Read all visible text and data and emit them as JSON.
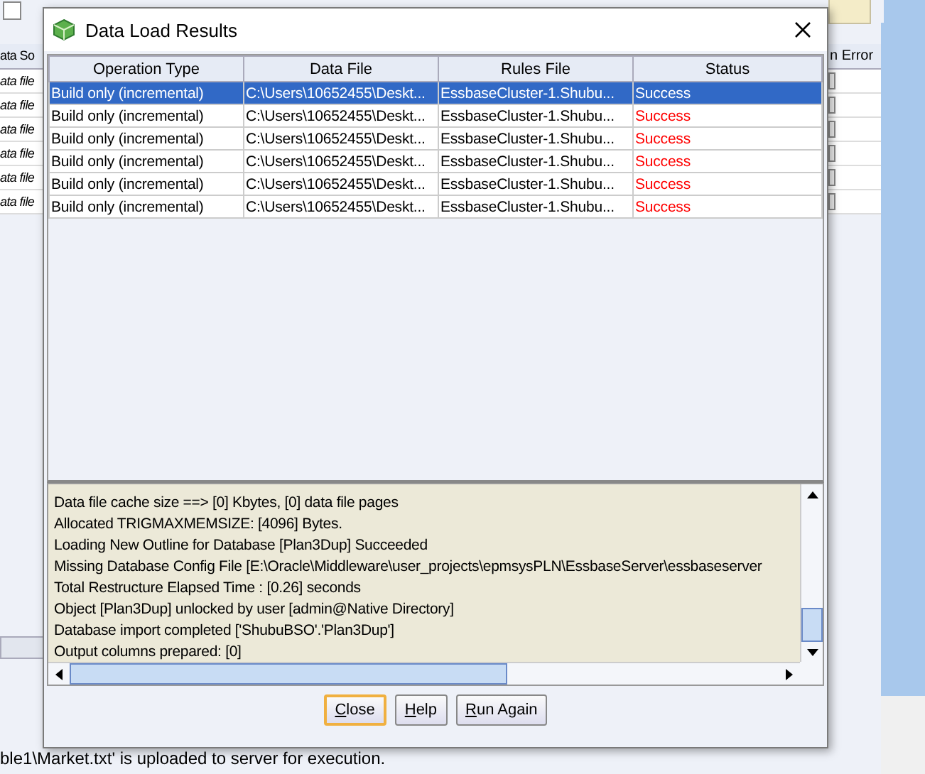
{
  "background": {
    "checkbox": {
      "checked": false
    },
    "table": {
      "column_1_header": "ata So",
      "column_2_header": "n Error",
      "rows": [
        {
          "column_1": "ata file",
          "checked": false
        },
        {
          "column_1": "ata file",
          "checked": false
        },
        {
          "column_1": "ata file",
          "checked": false
        },
        {
          "column_1": "ata file",
          "checked": false
        },
        {
          "column_1": "ata file",
          "checked": false
        },
        {
          "column_1": "ata file",
          "checked": false
        }
      ]
    },
    "status_text": "ble1\\Market.txt' is uploaded to server for execution."
  },
  "dialog": {
    "title": "Data Load Results",
    "table": {
      "columns": [
        "Operation Type",
        "Data File",
        "Rules File",
        "Status"
      ],
      "rows": [
        {
          "operation_type": "Build only (incremental)",
          "data_file": "C:\\Users\\10652455\\Deskt...",
          "rules_file": "EssbaseCluster-1.Shubu...",
          "status": "Success",
          "selected": true
        },
        {
          "operation_type": "Build only (incremental)",
          "data_file": "C:\\Users\\10652455\\Deskt...",
          "rules_file": "EssbaseCluster-1.Shubu...",
          "status": "Success",
          "selected": false
        },
        {
          "operation_type": "Build only (incremental)",
          "data_file": "C:\\Users\\10652455\\Deskt...",
          "rules_file": "EssbaseCluster-1.Shubu...",
          "status": "Success",
          "selected": false
        },
        {
          "operation_type": "Build only (incremental)",
          "data_file": "C:\\Users\\10652455\\Deskt...",
          "rules_file": "EssbaseCluster-1.Shubu...",
          "status": "Success",
          "selected": false
        },
        {
          "operation_type": "Build only (incremental)",
          "data_file": "C:\\Users\\10652455\\Deskt...",
          "rules_file": "EssbaseCluster-1.Shubu...",
          "status": "Success",
          "selected": false
        },
        {
          "operation_type": "Build only (incremental)",
          "data_file": "C:\\Users\\10652455\\Deskt...",
          "rules_file": "EssbaseCluster-1.Shubu...",
          "status": "Success",
          "selected": false
        }
      ]
    },
    "log": {
      "lines": [
        "Data file cache size ==> [0] Kbytes, [0] data file pages",
        "Allocated TRIGMAXMEMSIZE: [4096] Bytes.",
        "Loading New Outline for Database [Plan3Dup] Succeeded",
        "Missing Database Config File [E:\\Oracle\\Middleware\\user_projects\\epmsysPLN\\EssbaseServer\\essbaseserver",
        "Total Restructure Elapsed Time : [0.26] seconds",
        "Object [Plan3Dup] unlocked by user [admin@Native Directory]",
        "Database import completed ['ShubuBSO'.'Plan3Dup']",
        "Output columns prepared: [0]"
      ]
    },
    "buttons": [
      {
        "label": "Close",
        "default": true
      },
      {
        "label": "Help",
        "default": false
      },
      {
        "label": "Run Again",
        "default": false
      }
    ]
  }
}
